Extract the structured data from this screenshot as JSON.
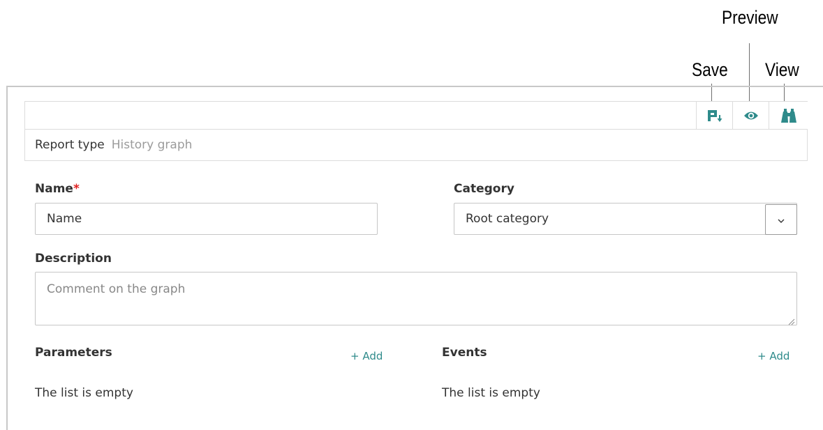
{
  "callouts": {
    "save": "Save",
    "preview": "Preview",
    "view": "View"
  },
  "toolbar": {
    "buttons": [
      {
        "name": "save",
        "icon": "save-icon"
      },
      {
        "name": "preview",
        "icon": "eye-icon"
      },
      {
        "name": "view",
        "icon": "binoculars-icon"
      }
    ],
    "icon_color": "#2f8b8b"
  },
  "report_type": {
    "label": "Report type",
    "value": "History graph"
  },
  "form": {
    "name": {
      "label": "Name",
      "required_marker": "*",
      "placeholder": "Name"
    },
    "category": {
      "label": "Category",
      "value": "Root category",
      "toggle_icon": "chevron-down-icon"
    },
    "description": {
      "label": "Description",
      "placeholder": "Comment on the graph"
    }
  },
  "parameters": {
    "title": "Parameters",
    "add_label": "+ Add",
    "empty_text": "The list is empty"
  },
  "events": {
    "title": "Events",
    "add_label": "+ Add",
    "empty_text": "The list is empty"
  },
  "colors": {
    "accent": "#2f8b8b",
    "required": "#e02020",
    "border": "#dcdcdc"
  }
}
